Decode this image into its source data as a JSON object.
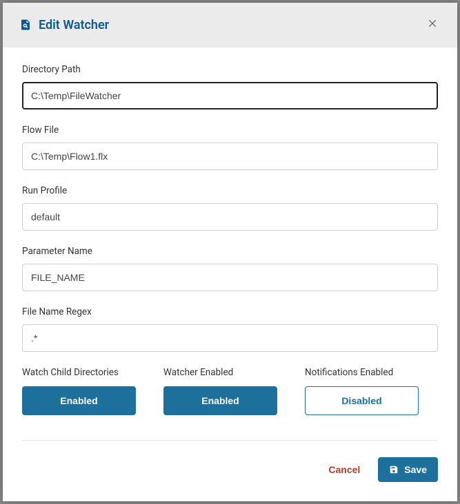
{
  "header": {
    "title": "Edit Watcher"
  },
  "fields": {
    "directoryPath": {
      "label": "Directory Path",
      "value": "C:\\Temp\\FileWatcher"
    },
    "flowFile": {
      "label": "Flow File",
      "value": "C:\\Temp\\Flow1.flx"
    },
    "runProfile": {
      "label": "Run Profile",
      "value": "default"
    },
    "parameterName": {
      "label": "Parameter Name",
      "value": "FILE_NAME"
    },
    "fileNameRegex": {
      "label": "File Name Regex",
      "value": ".*"
    }
  },
  "toggles": {
    "watchChild": {
      "label": "Watch Child Directories",
      "state": "Enabled"
    },
    "watcherEnabled": {
      "label": "Watcher Enabled",
      "state": "Enabled"
    },
    "notifications": {
      "label": "Notifications Enabled",
      "state": "Disabled"
    }
  },
  "footer": {
    "cancel": "Cancel",
    "save": "Save"
  }
}
